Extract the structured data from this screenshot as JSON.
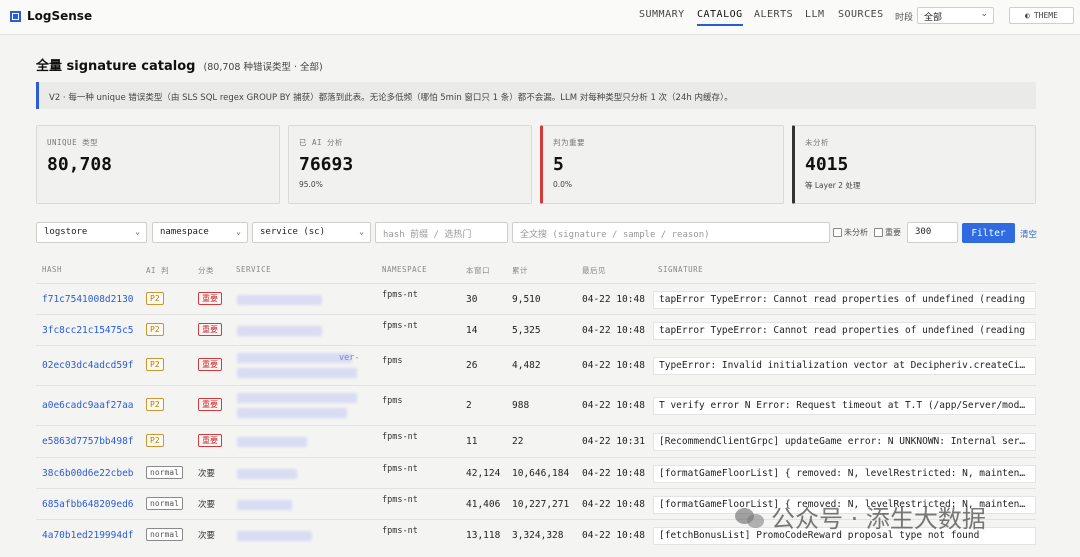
{
  "app": {
    "name": "LogSense"
  },
  "nav": {
    "items": [
      "SUMMARY",
      "CATALOG",
      "ALERTS",
      "LLM",
      "SOURCES"
    ],
    "active": "CATALOG",
    "period_label": "时段",
    "period_value": "全部",
    "theme_label": "THEME"
  },
  "page": {
    "title": "全量 signature catalog",
    "subtitle": "(80,708 种错误类型 · 全部)",
    "notice": "V2 · 每一种 unique 错误类型（由 SLS SQL regex GROUP BY 捕获）都落到此表。无论多低频（哪怕 5min 窗口只 1 条）都不会漏。LLM 对每种类型只分析 1 次（24h 内缓存）。"
  },
  "stats": [
    {
      "label": "UNIQUE 类型",
      "value": "80,708",
      "sub": ""
    },
    {
      "label": "已 AI 分析",
      "value": "76693",
      "sub": "95.0%"
    },
    {
      "label": "判为重要",
      "value": "5",
      "sub": "0.0%"
    },
    {
      "label": "未分析",
      "value": "4015",
      "sub": "等 Layer 2 处理"
    }
  ],
  "filters": {
    "logstore": "logstore",
    "namespace": "namespace",
    "service": "service (sc)",
    "hash_placeholder": "hash 前缀 / 选热门",
    "fulltext_placeholder": "全文搜 (signature / sample / reason)",
    "chk_unanalyzed": "未分析",
    "chk_important": "重要",
    "limit": "300",
    "filter_button": "Filter",
    "clear": "清空"
  },
  "table": {
    "headers": [
      "HASH",
      "AI 判",
      "分类",
      "SERVICE",
      "NAMESPACE",
      "本窗口",
      "累计",
      "最后见",
      "SIGNATURE"
    ],
    "rows": [
      {
        "hash": "f71c7541008d2130",
        "ai": "P2",
        "cls": "重要",
        "service": "",
        "ns": "fpms-nt",
        "win": "30",
        "total": "9,510",
        "last": "04-22 10:48",
        "sig": "tapError TypeError: Cannot read properties of undefined (reading"
      },
      {
        "hash": "3fc8cc21c15475c5",
        "ai": "P2",
        "cls": "重要",
        "service": "",
        "ns": "fpms-nt",
        "win": "14",
        "total": "5,325",
        "last": "04-22 10:48",
        "sig": "tapError TypeError: Cannot read properties of undefined (reading"
      },
      {
        "hash": "02ec03dc4adcd59f",
        "ai": "P2",
        "cls": "重要",
        "service": "ver-",
        "ns": "fpms",
        "win": "26",
        "total": "4,482",
        "last": "04-22 10:48",
        "sig": "TypeError: Invalid initialization vector at Decipheriv.createCipher"
      },
      {
        "hash": "a0e6cadc9aaf27aa",
        "ai": "P2",
        "cls": "重要",
        "service": "",
        "ns": "fpms",
        "win": "2",
        "total": "988",
        "last": "04-22 10:48",
        "sig": "T verify error N Error: Request timeout at T.T (/app/Server/modules"
      },
      {
        "hash": "e5863d7757bb498f",
        "ai": "P2",
        "cls": "重要",
        "service": "",
        "ns": "fpms-nt",
        "win": "11",
        "total": "22",
        "last": "04-22 10:31",
        "sig": "[RecommendClientGrpc] updateGame error: N UNKNOWN: Internal server"
      },
      {
        "hash": "38c6b00d6e22cbeb",
        "ai": "normal",
        "cls": "次要",
        "service": "",
        "ns": "fpms-nt",
        "win": "42,124",
        "total": "10,646,184",
        "last": "04-22 10:48",
        "sig": "[formatGameFloorList] { removed: N, levelRestricted: N, maintenance"
      },
      {
        "hash": "685afbb648209ed6",
        "ai": "normal",
        "cls": "次要",
        "service": "",
        "ns": "fpms-nt",
        "win": "41,406",
        "total": "10,227,271",
        "last": "04-22 10:48",
        "sig": "[formatGameFloorList] { removed: N, levelRestricted: N, maintenance"
      },
      {
        "hash": "4a70b1ed219994df",
        "ai": "normal",
        "cls": "次要",
        "service": "",
        "ns": "fpms-nt",
        "win": "13,118",
        "total": "3,324,328",
        "last": "04-22 10:48",
        "sig": "[fetchBonusList] PromoCodeReward proposal type not found"
      }
    ]
  },
  "watermark": "公众号 · 添生大数据",
  "colors": {
    "accent": "#2a5cd8",
    "important": "#d23b3b",
    "p2": "#c9962f"
  }
}
